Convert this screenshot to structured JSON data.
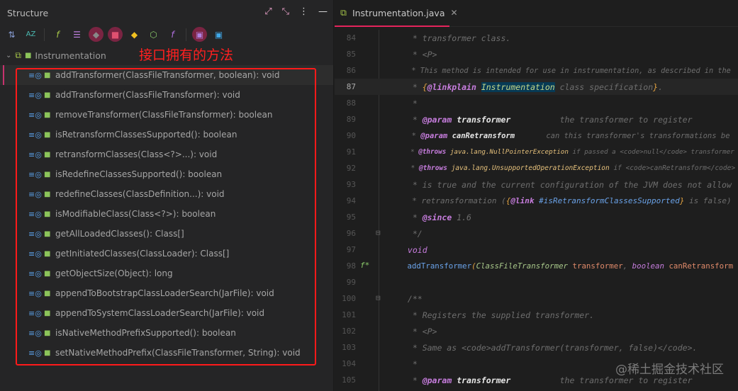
{
  "structure": {
    "title": "Structure",
    "root": "Instrumentation",
    "annotation": "接口拥有的方法",
    "items": [
      "addTransformer(ClassFileTransformer, boolean): void",
      "addTransformer(ClassFileTransformer): void",
      "removeTransformer(ClassFileTransformer): boolean",
      "isRetransformClassesSupported(): boolean",
      "retransformClasses(Class<?>...): void",
      "isRedefineClassesSupported(): boolean",
      "redefineClasses(ClassDefinition...): void",
      "isModifiableClass(Class<?>): boolean",
      "getAllLoadedClasses(): Class[]",
      "getInitiatedClasses(ClassLoader): Class[]",
      "getObjectSize(Object): long",
      "appendToBootstrapClassLoaderSearch(JarFile): void",
      "appendToSystemClassLoaderSearch(JarFile): void",
      "isNativeMethodPrefixSupported(): boolean",
      "setNativeMethodPrefix(ClassFileTransformer, String): void"
    ]
  },
  "editor": {
    "tab": "Instrumentation.java",
    "current_line": 87,
    "lines": [
      {
        "n": "84",
        "t": [
          [
            "c",
            "  * transformer class."
          ]
        ]
      },
      {
        "n": "85",
        "t": [
          [
            "c",
            "  * <P>"
          ]
        ]
      },
      {
        "n": "86",
        "t": [
          [
            "c",
            "  * This method is intended for use in instrumentation, as described in the"
          ]
        ]
      },
      {
        "n": "87",
        "t": [
          [
            "c",
            "  * "
          ],
          [
            "br",
            "{"
          ],
          [
            "tag",
            "@linkplain"
          ],
          [
            "c",
            " "
          ],
          [
            "hl",
            "Instrumentation"
          ],
          [
            "c",
            " class specification"
          ],
          [
            "br",
            "}"
          ],
          [
            "c",
            "."
          ]
        ]
      },
      {
        "n": "88",
        "t": [
          [
            "c",
            "  *"
          ]
        ]
      },
      {
        "n": "89",
        "t": [
          [
            "c",
            "  * "
          ],
          [
            "tag",
            "@param"
          ],
          [
            "c",
            " "
          ],
          [
            "pn",
            "transformer"
          ],
          [
            "c",
            "          the transformer to register"
          ]
        ]
      },
      {
        "n": "90",
        "t": [
          [
            "c",
            "  * "
          ],
          [
            "tag",
            "@param"
          ],
          [
            "c",
            " "
          ],
          [
            "pn",
            "canRetransform"
          ],
          [
            "c",
            "       can this transformer's transformations be"
          ]
        ]
      },
      {
        "n": "91",
        "t": [
          [
            "c",
            "  * "
          ],
          [
            "tag",
            "@throws"
          ],
          [
            "c",
            " "
          ],
          [
            "ex",
            "java.lang.NullPointerException"
          ],
          [
            "c",
            " if passed a <code>null</code> transformer"
          ]
        ]
      },
      {
        "n": "92",
        "t": [
          [
            "c",
            "  * "
          ],
          [
            "tag",
            "@throws"
          ],
          [
            "c",
            " "
          ],
          [
            "ex",
            "java.lang.UnsupportedOperationException"
          ],
          [
            "c",
            " if <code>canRetransform</code>"
          ]
        ]
      },
      {
        "n": "93",
        "t": [
          [
            "c",
            "  * is true and the current configuration of the JVM does not allow"
          ]
        ]
      },
      {
        "n": "94",
        "t": [
          [
            "c",
            "  * retransformation ("
          ],
          [
            "br",
            "{"
          ],
          [
            "tag",
            "@link"
          ],
          [
            "c",
            " "
          ],
          [
            "lk",
            "#isRetransformClassesSupported"
          ],
          [
            "br",
            "}"
          ],
          [
            "c",
            " is false)"
          ]
        ]
      },
      {
        "n": "95",
        "t": [
          [
            "c",
            "  * "
          ],
          [
            "tag",
            "@since"
          ],
          [
            "c",
            " 1.6"
          ]
        ]
      },
      {
        "n": "96",
        "t": [
          [
            "c",
            "  */"
          ]
        ],
        "fold": true
      },
      {
        "n": "97",
        "t": [
          [
            "kw",
            " void"
          ]
        ]
      },
      {
        "n": "98",
        "t": [
          [
            "fn",
            " addTransformer"
          ],
          [
            "br",
            "("
          ],
          [
            "ty",
            "ClassFileTransformer"
          ],
          [
            "par",
            " transformer"
          ],
          [
            "c",
            ", "
          ],
          [
            "kw",
            "boolean"
          ],
          [
            "par",
            " canRetransform"
          ]
        ],
        "impl": true
      },
      {
        "n": "99",
        "t": []
      },
      {
        "n": "100",
        "t": [
          [
            "c",
            " /**"
          ]
        ],
        "fold": true
      },
      {
        "n": "101",
        "t": [
          [
            "c",
            "  * Registers the supplied transformer."
          ]
        ]
      },
      {
        "n": "102",
        "t": [
          [
            "c",
            "  * <P>"
          ]
        ]
      },
      {
        "n": "103",
        "t": [
          [
            "c",
            "  * Same as <code>addTransformer(transformer, false)</code>."
          ]
        ]
      },
      {
        "n": "104",
        "t": [
          [
            "c",
            "  *"
          ]
        ]
      },
      {
        "n": "105",
        "t": [
          [
            "c",
            "  * "
          ],
          [
            "tag",
            "@param"
          ],
          [
            "c",
            " "
          ],
          [
            "pn",
            "transformer"
          ],
          [
            "c",
            "          the transformer to register"
          ]
        ]
      }
    ]
  },
  "watermark": "@稀土掘金技术社区"
}
